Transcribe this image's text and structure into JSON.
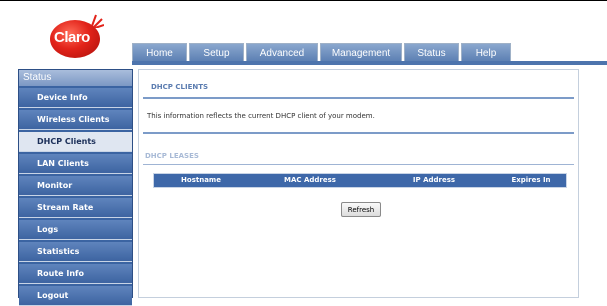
{
  "brand": {
    "logo_text": "Claro"
  },
  "nav": {
    "tabs": [
      {
        "label": "Home"
      },
      {
        "label": "Setup"
      },
      {
        "label": "Advanced"
      },
      {
        "label": "Management"
      },
      {
        "label": "Status"
      },
      {
        "label": "Help"
      }
    ]
  },
  "sidebar": {
    "title": "Status",
    "items": [
      {
        "label": "Device Info"
      },
      {
        "label": "Wireless Clients"
      },
      {
        "label": "DHCP Clients",
        "active": true
      },
      {
        "label": "LAN Clients"
      },
      {
        "label": "Monitor"
      },
      {
        "label": "Stream Rate"
      },
      {
        "label": "Logs"
      },
      {
        "label": "Statistics"
      },
      {
        "label": "Route Info"
      },
      {
        "label": "Logout"
      }
    ]
  },
  "main": {
    "section_title": "DHCP CLIENTS",
    "info_text": "This information reflects the current DHCP client of your modem.",
    "leases_title": "DHCP LEASES",
    "table": {
      "columns": [
        "Hostname",
        "MAC Address",
        "IP Address",
        "Expires In"
      ],
      "rows": []
    },
    "refresh_label": "Refresh"
  },
  "colors": {
    "accent": "#3e68a9",
    "brand_red": "#e2231a",
    "section_title": "#5b7cb0"
  }
}
